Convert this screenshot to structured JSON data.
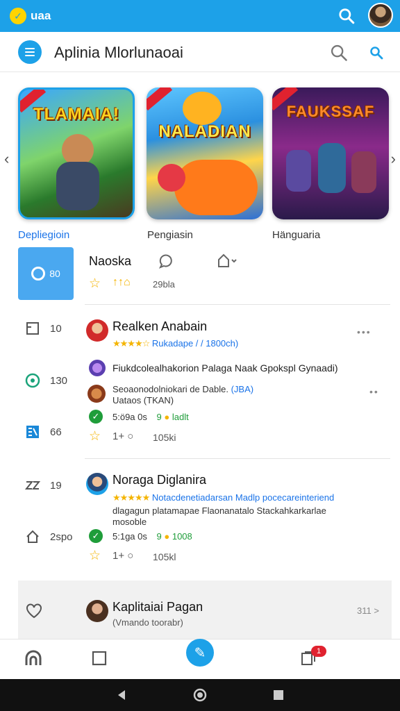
{
  "topbar": {
    "brand_text": "uaa",
    "brand_icon": "shield-check-icon",
    "accent": "#1da1e8"
  },
  "appbar": {
    "title": "Aplinia Mlorlunaoai"
  },
  "carousel": {
    "items": [
      {
        "title": "TLAMAIA!",
        "label": "Depliegioin",
        "label_color": "#1a73e8"
      },
      {
        "title": "NALADIAN",
        "label": "Pengiasin",
        "label_color": "#333333"
      },
      {
        "title": "FAUKSSAF",
        "label": "Hänguaria",
        "label_color": "#333333"
      }
    ]
  },
  "left_nav": {
    "featured_count": "80",
    "items": [
      {
        "icon": "square-icon",
        "count": "10"
      },
      {
        "icon": "refresh-circle-icon",
        "count": "130"
      },
      {
        "icon": "grid-icon",
        "count": "66"
      },
      {
        "icon": "zigzag-icon",
        "count": "19"
      },
      {
        "icon": "home-icon",
        "count": "2spo"
      },
      {
        "icon": "heart-icon",
        "count": ""
      }
    ]
  },
  "feed": {
    "header": {
      "title": "Naoska",
      "rating_text": "29bla"
    },
    "post1": {
      "title": "Realken Anabain",
      "subtitle": "Rukadape / / 1800ch)",
      "line1": "Fiukdcolealhakorion Palaga Naak Gpokspl Gynaadi)",
      "line2a": "Seoaonodolniokari de Dable.",
      "line2a_link": "(JBA)",
      "line2b": "Uataos (TKAN)",
      "stat_a": "5:ö9a 0s",
      "stat_b": "9",
      "stat_c": "ladlt",
      "reactions": "1+",
      "count": "105ki"
    },
    "post2": {
      "title": "Noraga Diglanira",
      "subtitle": "Notacdenetiadarsan Madlp pocecareinteriend",
      "body1": "dlagagun platamapae Flaonanatalo Stackahkarkarlae",
      "body2": "mosoble",
      "stat_a": "5:1ga 0s",
      "stat_b": "9",
      "stat_c": "1008",
      "reactions": "1+",
      "count": "105kl"
    },
    "post3": {
      "title": "Kaplitaiai Pagan",
      "subtitle": "(Vmando toorabr)",
      "meta": "311 >"
    }
  },
  "bottom_nav": {
    "badge": "1"
  }
}
